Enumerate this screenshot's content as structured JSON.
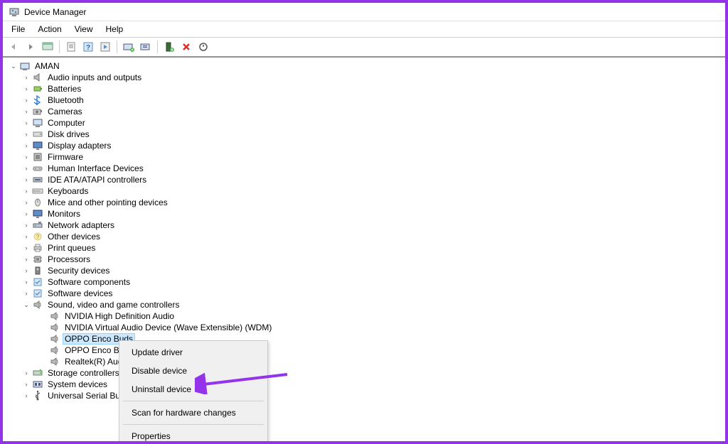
{
  "window": {
    "title": "Device Manager"
  },
  "menubar": [
    "File",
    "Action",
    "View",
    "Help"
  ],
  "root_name": "AMAN",
  "categories": [
    {
      "label": "Audio inputs and outputs",
      "icon": "speaker"
    },
    {
      "label": "Batteries",
      "icon": "battery"
    },
    {
      "label": "Bluetooth",
      "icon": "bluetooth"
    },
    {
      "label": "Cameras",
      "icon": "camera"
    },
    {
      "label": "Computer",
      "icon": "computer"
    },
    {
      "label": "Disk drives",
      "icon": "disk"
    },
    {
      "label": "Display adapters",
      "icon": "display"
    },
    {
      "label": "Firmware",
      "icon": "firmware"
    },
    {
      "label": "Human Interface Devices",
      "icon": "hid"
    },
    {
      "label": "IDE ATA/ATAPI controllers",
      "icon": "ide"
    },
    {
      "label": "Keyboards",
      "icon": "keyboard"
    },
    {
      "label": "Mice and other pointing devices",
      "icon": "mouse"
    },
    {
      "label": "Monitors",
      "icon": "monitor"
    },
    {
      "label": "Network adapters",
      "icon": "network"
    },
    {
      "label": "Other devices",
      "icon": "other"
    },
    {
      "label": "Print queues",
      "icon": "printer"
    },
    {
      "label": "Processors",
      "icon": "cpu"
    },
    {
      "label": "Security devices",
      "icon": "security"
    },
    {
      "label": "Software components",
      "icon": "software"
    },
    {
      "label": "Software devices",
      "icon": "software"
    },
    {
      "label": "Sound, video and game controllers",
      "icon": "sound",
      "expanded": true,
      "children": [
        {
          "label": "NVIDIA High Definition Audio"
        },
        {
          "label": "NVIDIA Virtual Audio Device (Wave Extensible) (WDM)"
        },
        {
          "label": "OPPO Enco Buds",
          "selected": true
        },
        {
          "label": "OPPO Enco Buds"
        },
        {
          "label": "Realtek(R) Audio"
        }
      ]
    },
    {
      "label": "Storage controllers",
      "icon": "storage"
    },
    {
      "label": "System devices",
      "icon": "system"
    },
    {
      "label": "Universal Serial Bus",
      "icon": "usb",
      "truncated": true
    }
  ],
  "context_menu": {
    "items": [
      "Update driver",
      "Disable device",
      "Uninstall device",
      "---",
      "Scan for hardware changes",
      "---",
      "Properties"
    ],
    "highlighted": "Uninstall device"
  }
}
